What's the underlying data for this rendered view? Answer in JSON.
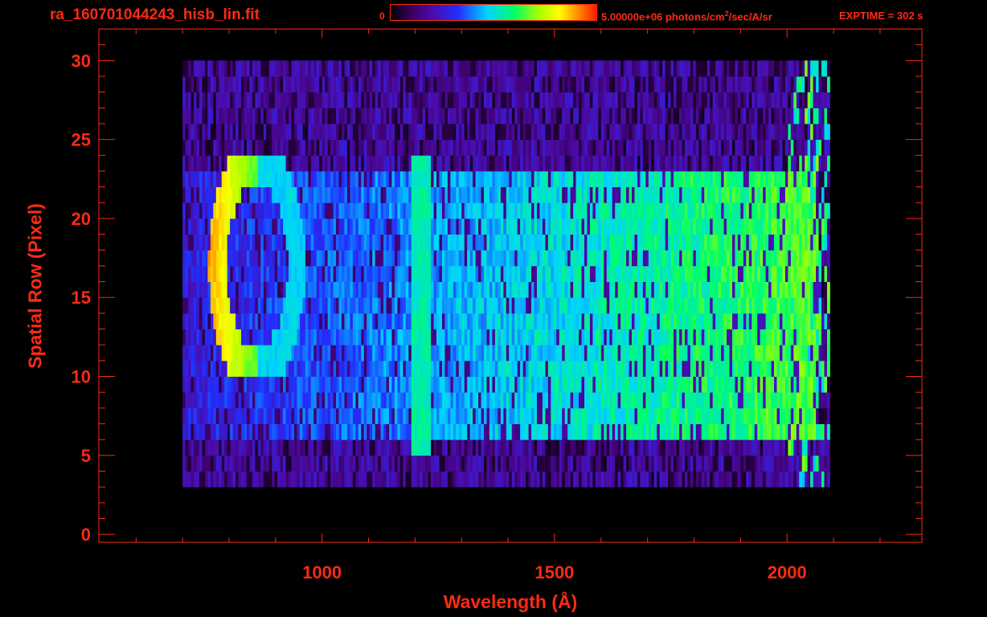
{
  "title": "ra_160701044243_hisb_lin.fit",
  "colorbar": {
    "min_label": "0",
    "max_label_prefix": "5.00000e+06 photons/cm",
    "max_label_sup": "2",
    "max_label_suffix": "/sec/A/sr",
    "colormap": "rainbow"
  },
  "exptime": "EXPTIME = 302 s",
  "colors": {
    "axis": "#ff2a14",
    "background": "#000000"
  },
  "chart_data": {
    "type": "heatmap",
    "xlabel": "Wavelength (Å)",
    "ylabel": "Spatial Row (Pixel)",
    "xlim": [
      520,
      2290
    ],
    "ylim": [
      -0.5,
      32
    ],
    "xticks": [
      {
        "value": 1000,
        "label": "1000"
      },
      {
        "value": 1500,
        "label": "1500"
      },
      {
        "value": 2000,
        "label": "2000"
      }
    ],
    "yticks": [
      {
        "value": 0,
        "label": "0"
      },
      {
        "value": 5,
        "label": "5"
      },
      {
        "value": 10,
        "label": "10"
      },
      {
        "value": 15,
        "label": "15"
      },
      {
        "value": 20,
        "label": "20"
      },
      {
        "value": 25,
        "label": "25"
      },
      {
        "value": 30,
        "label": "30"
      }
    ],
    "x_minor_step": 100,
    "y_minor_step": 1,
    "data_extent": {
      "x": [
        700,
        2090
      ],
      "y": [
        3,
        30
      ]
    },
    "features": [
      {
        "kind": "continuum_rows",
        "x": [
          700,
          2060
        ],
        "y": [
          6,
          23
        ]
      },
      {
        "kind": "emission_line",
        "x": 1215,
        "y": [
          5,
          24
        ]
      },
      {
        "kind": "ring",
        "x": [
          800,
          1000
        ],
        "y": [
          10,
          24
        ],
        "center_x": 860,
        "center_y": 17
      }
    ]
  }
}
